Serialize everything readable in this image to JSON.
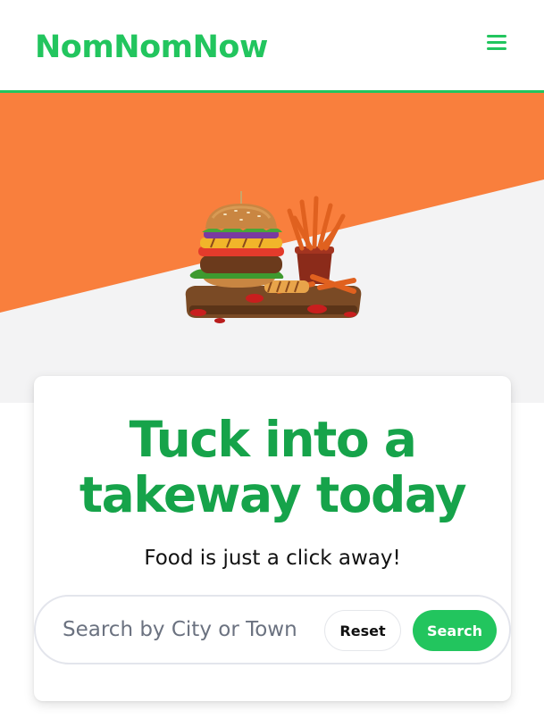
{
  "header": {
    "logo": "NomNomNow",
    "menu_icon": "hamburger-menu-icon"
  },
  "hero": {
    "image": "burger-and-fries-illustration",
    "accent_color": "#f97f3d",
    "background_color": "#f3f3f4"
  },
  "card": {
    "headline": "Tuck into a takeway today",
    "subtext": "Food is just a click away!"
  },
  "search": {
    "placeholder": "Search by City or Town",
    "value": "",
    "reset_label": "Reset",
    "search_label": "Search"
  },
  "colors": {
    "brand": "#22c55e",
    "headline": "#16a34a"
  }
}
